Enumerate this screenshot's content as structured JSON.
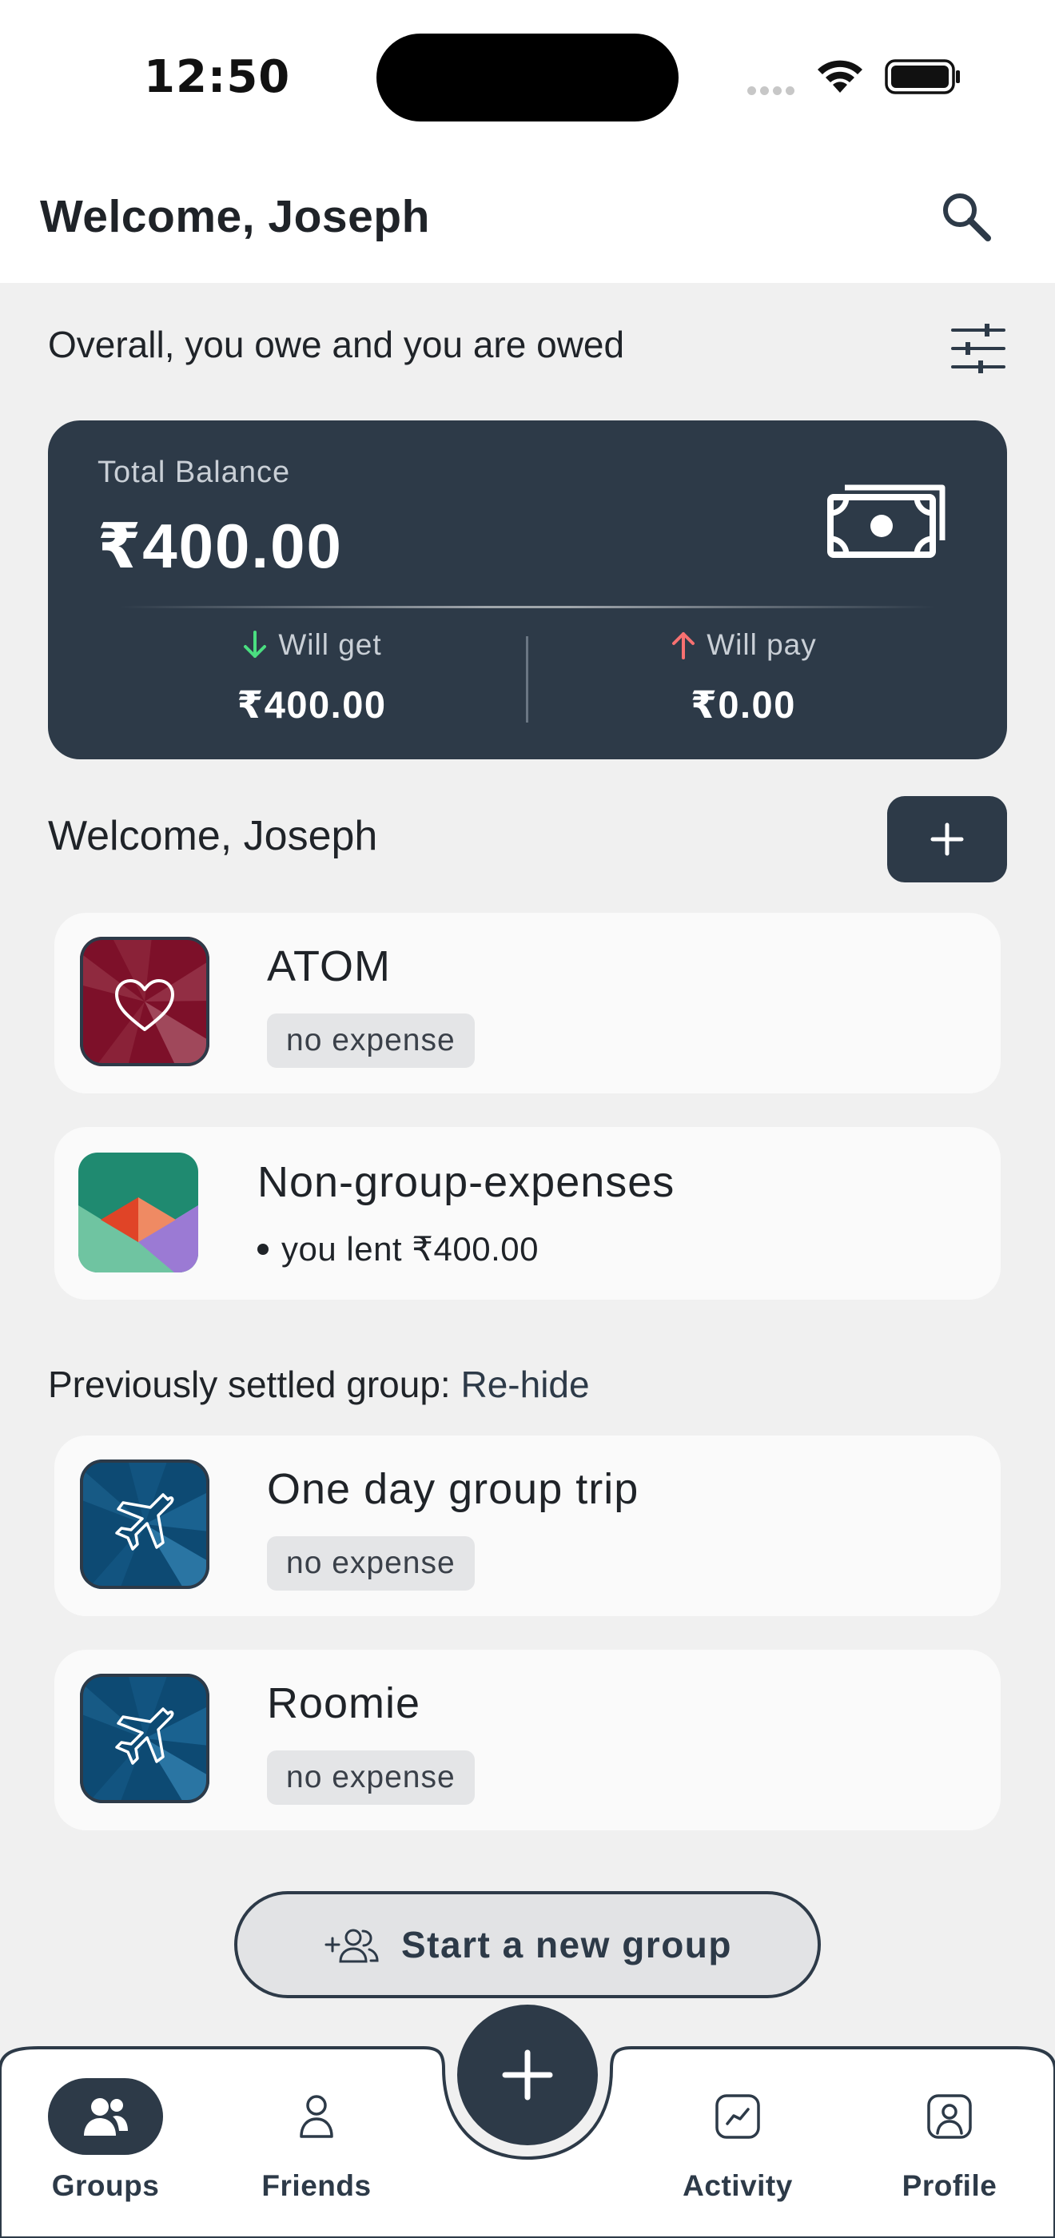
{
  "status_bar": {
    "time": "12:50"
  },
  "header": {
    "title": "Welcome, Joseph"
  },
  "overview": {
    "title": "Overall, you owe and you are owed"
  },
  "balance": {
    "label": "Total Balance",
    "amount": "₹400.00",
    "will_get_label": "Will get",
    "will_get_amount": "₹400.00",
    "will_pay_label": "Will pay",
    "will_pay_amount": "₹0.00",
    "get_color": "#4ade80",
    "pay_color": "#f87171"
  },
  "groups_section": {
    "title": "Welcome, Joseph"
  },
  "groups": [
    {
      "name": "ATOM",
      "badge": "no expense",
      "icon": "heart-icon"
    },
    {
      "name": "Non-group-expenses",
      "meta": "you lent ₹400.00",
      "icon": "envelope-icon"
    }
  ],
  "settled": {
    "label": "Previously settled group:",
    "link": "Re-hide",
    "groups": [
      {
        "name": "One day group trip",
        "badge": "no expense",
        "icon": "airplane-icon"
      },
      {
        "name": "Roomie",
        "badge": "no expense",
        "icon": "airplane-icon"
      }
    ]
  },
  "start_group": {
    "label": "Start a new group"
  },
  "nav": {
    "groups": "Groups",
    "friends": "Friends",
    "activity": "Activity",
    "profile": "Profile",
    "active": "Groups"
  },
  "colors": {
    "primary": "#2d3a48",
    "background": "#f0f0f0",
    "card": "#fafafa"
  }
}
